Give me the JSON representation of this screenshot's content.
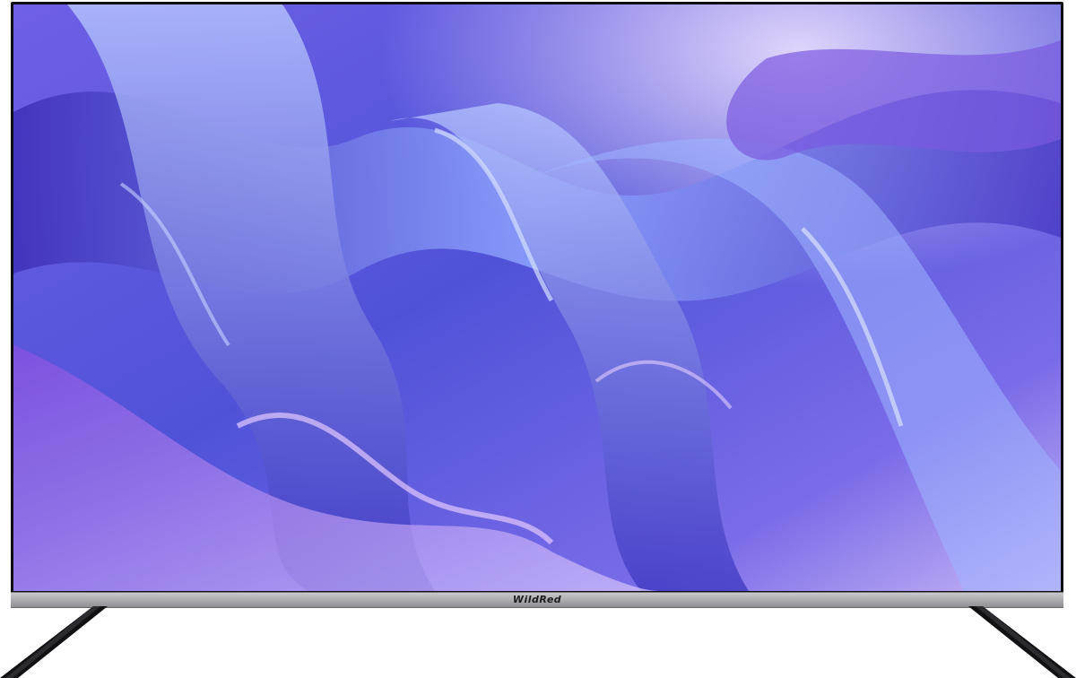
{
  "product": {
    "brand_logo": "WildRed"
  },
  "colors": {
    "screen_base": "#5a56d6",
    "wave_deep": "#3d2fb8",
    "wave_light": "#9fb4ff",
    "highlight": "#d9c9ff",
    "bezel": "#a9a9ad",
    "frame": "#0d0d12"
  }
}
